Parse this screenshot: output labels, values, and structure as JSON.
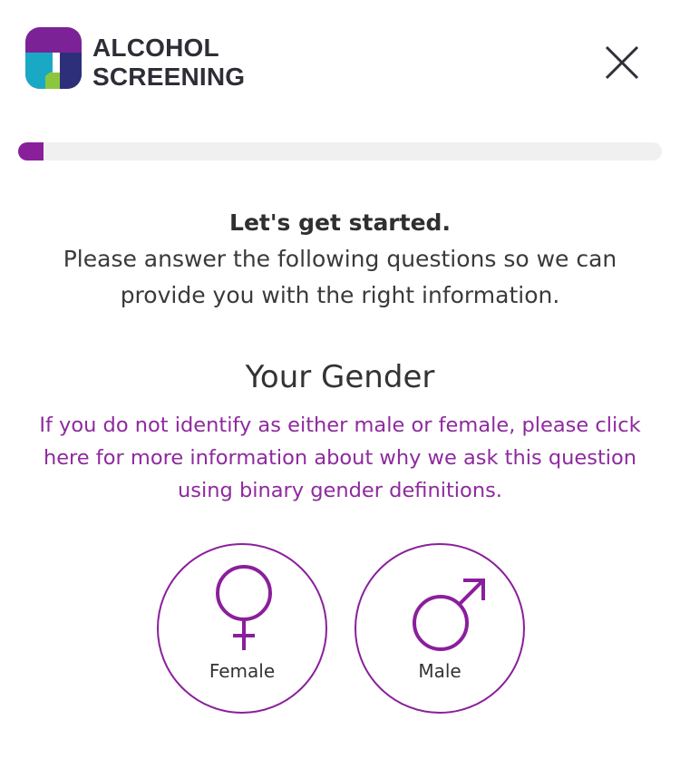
{
  "header": {
    "brand_line1": "ALCOHOL",
    "brand_line2": "SCREENING",
    "close_icon": "close-icon"
  },
  "progress": {
    "value_percent": 4,
    "color": "#8a1f9b"
  },
  "intro": {
    "title": "Let's get started.",
    "text": "Please answer the following questions so we can provide you with the right information."
  },
  "gender": {
    "title": "Your Gender",
    "info_link": "If you do not identify as either male or female, please click here for more information about why we ask this question using binary gender definitions.",
    "options": [
      {
        "label": "Female",
        "icon": "female-symbol-icon"
      },
      {
        "label": "Male",
        "icon": "male-symbol-icon"
      }
    ]
  },
  "colors": {
    "accent": "#8a1f9b",
    "link": "#8e2a9e",
    "text": "#333333"
  }
}
